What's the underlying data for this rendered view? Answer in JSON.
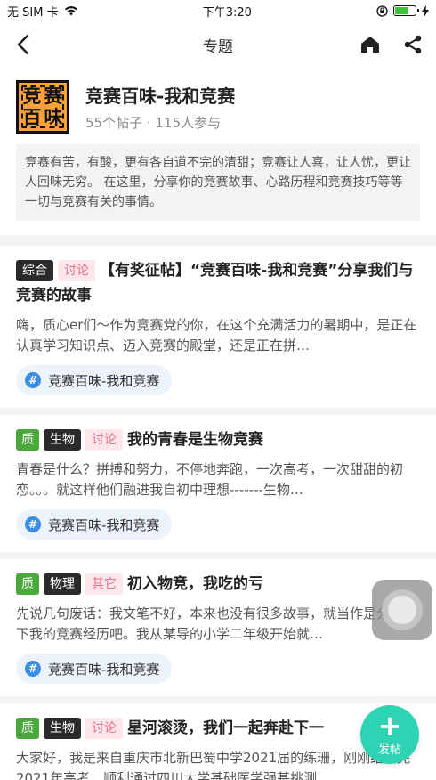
{
  "status_bar": {
    "carrier": "无 SIM 卡",
    "time": "下午3:20"
  },
  "nav": {
    "title": "专题"
  },
  "topic": {
    "logo_chars": [
      "竞",
      "赛",
      "百",
      "味"
    ],
    "name": "竞赛百味-我和竞赛",
    "stats": "55个帖子 · 115人参与",
    "description": "竞赛有苦，有酸，更有各自道不完的清甜；竞赛让人喜，让人忧，更让人回味无穷。 在这里，分享你的竞赛故事、心路历程和竞赛技巧等等一切与竞赛有关的事情。"
  },
  "posts": [
    {
      "tags": [
        "综合",
        "讨论"
      ],
      "title": "【有奖征帖】“竞赛百味-我和竞赛”分享我们与竞赛的故事",
      "excerpt": "嗨，质心er们～作为竞赛党的你，在这个充满活力的暑期中，是正在认真学习知识点、迈入竞赛的殿堂，还是正在拼…",
      "topic_chip": "竞赛百味-我和竞赛"
    },
    {
      "badge": "质",
      "tags": [
        "生物",
        "讨论"
      ],
      "title": "我的青春是生物竞赛",
      "excerpt": "青春是什么？拼搏和努力，不停地奔跑，一次高考，一次甜甜的初恋。。。就这样他们融进我自初中理想-------生物…",
      "topic_chip": "竞赛百味-我和竞赛"
    },
    {
      "badge": "质",
      "tags": [
        "物理",
        "其它"
      ],
      "title": "初入物竞，我吃的亏",
      "excerpt": "先说几句废话：我文笔不好，本来也没有很多故事，就当作是分享一下我的竞赛经历吧。我从某导的小学二年级开始就…",
      "topic_chip": "竞赛百味-我和竞赛"
    },
    {
      "badge": "质",
      "tags": [
        "生物",
        "讨论"
      ],
      "title": "星河滚烫，我们一起奔赴下一",
      "excerpt": "大家好，我是来自重庆市北新巴蜀中学2021届的练珊，刚刚结束完2021年高考，顺利通过四川大学基础医学强基挑测…"
    }
  ],
  "fab": {
    "plus": "+",
    "label": "发帖"
  },
  "colors": {
    "fab": "#2dd4b4",
    "quality_badge": "#4aa83c",
    "tag_dark": "#2b2b2b",
    "tag_pink_bg": "#fde7ea",
    "tag_pink_text": "#e8708a",
    "topic_chip_icon": "#3a8ee6"
  }
}
